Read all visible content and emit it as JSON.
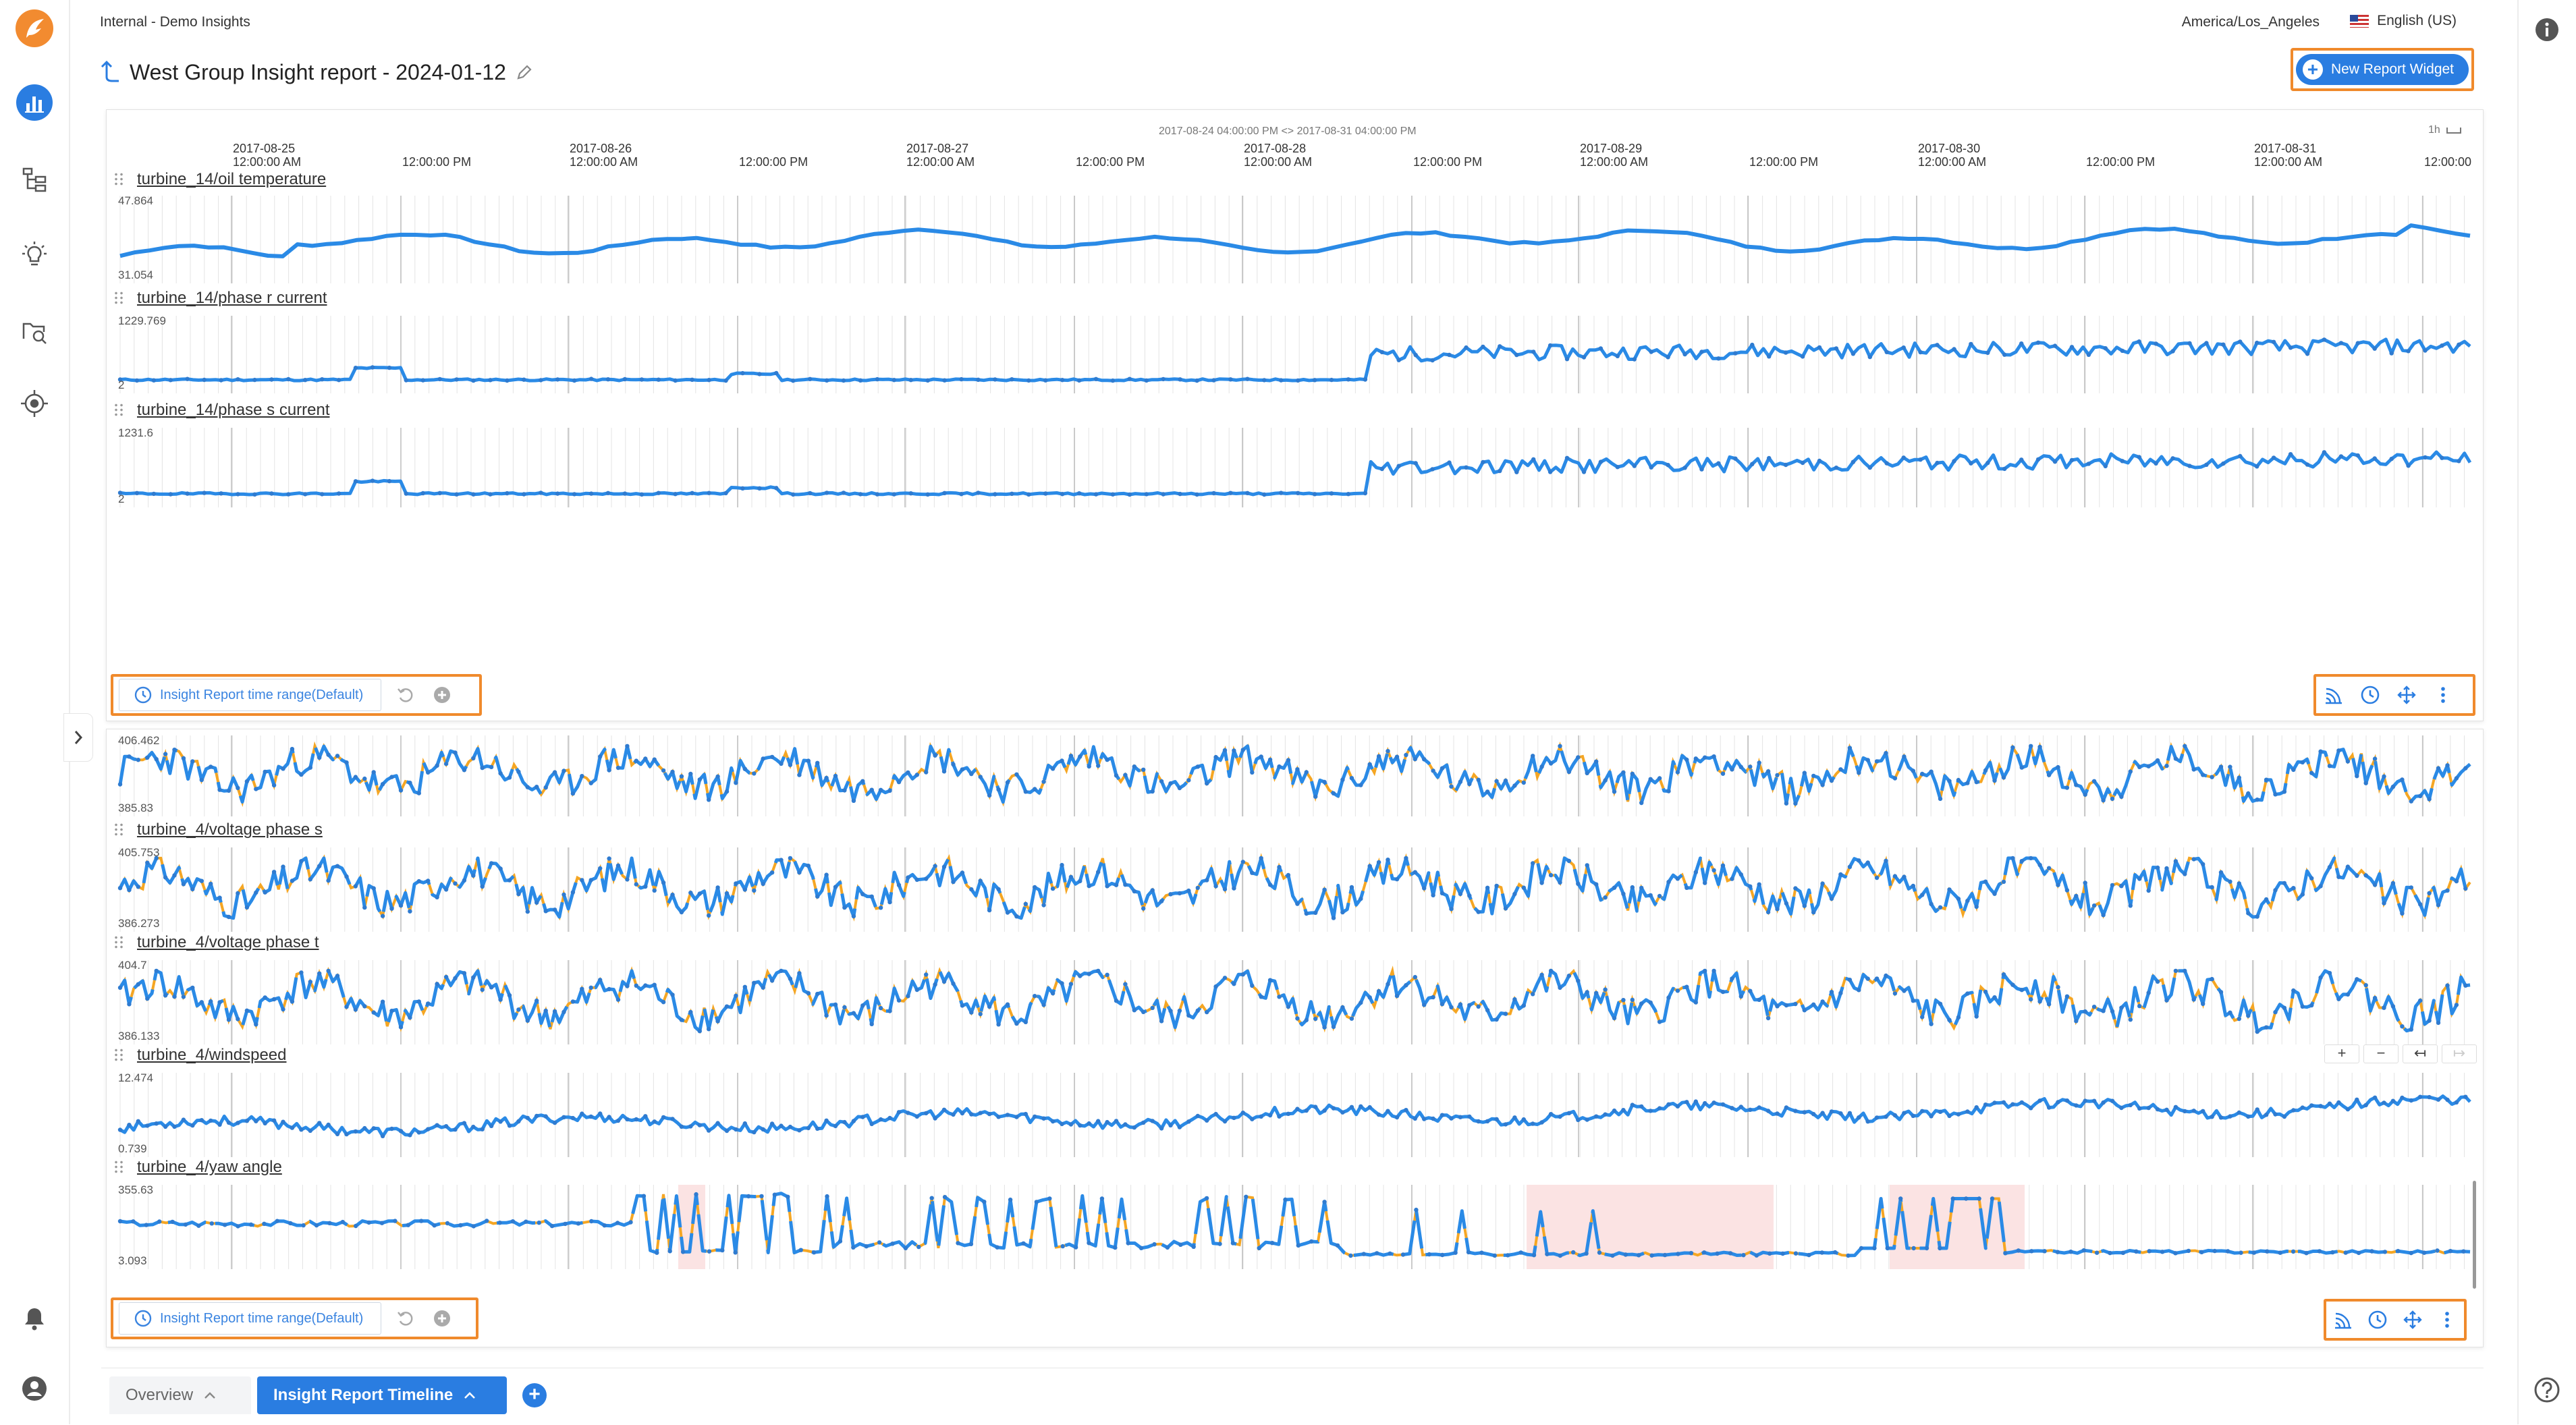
{
  "app": {
    "breadcrumb": "Internal - Demo Insights",
    "timezone": "America/Los_Angeles",
    "language": "English (US)"
  },
  "report": {
    "title": "West Group Insight report - 2024-01-12",
    "new_widget_label": "New Report Widget"
  },
  "timeline": {
    "range_caption": "2017-08-24 04:00:00 PM <> 2017-08-31 04:00:00 PM",
    "interval_label": "1h",
    "ticks": [
      {
        "date": "2017-08-25",
        "time": "12:00:00 AM"
      },
      {
        "date": "",
        "time": "12:00:00 PM"
      },
      {
        "date": "2017-08-26",
        "time": "12:00:00 AM"
      },
      {
        "date": "",
        "time": "12:00:00 PM"
      },
      {
        "date": "2017-08-27",
        "time": "12:00:00 AM"
      },
      {
        "date": "",
        "time": "12:00:00 PM"
      },
      {
        "date": "2017-08-28",
        "time": "12:00:00 AM"
      },
      {
        "date": "",
        "time": "12:00:00 PM"
      },
      {
        "date": "2017-08-29",
        "time": "12:00:00 AM"
      },
      {
        "date": "",
        "time": "12:00:00 PM"
      },
      {
        "date": "2017-08-30",
        "time": "12:00:00 AM"
      },
      {
        "date": "",
        "time": "12:00:00 PM"
      },
      {
        "date": "2017-08-31",
        "time": "12:00:00 AM"
      },
      {
        "date": "",
        "time": "12:00:00"
      }
    ]
  },
  "widget1": {
    "charts": [
      {
        "name": "turbine_14/oil temperature",
        "ymax": "47.864",
        "ymin": "31.054"
      },
      {
        "name": "turbine_14/phase r current",
        "ymax": "1229.769",
        "ymin": "2"
      },
      {
        "name": "turbine_14/phase s current",
        "ymax": "1231.6",
        "ymin": "2"
      }
    ],
    "range_button": "Insight Report time range(Default)"
  },
  "widget2": {
    "charts": [
      {
        "name": "",
        "ymax": "406.462",
        "ymin": "385.83"
      },
      {
        "name": "turbine_4/voltage phase s",
        "ymax": "405.753",
        "ymin": "386.273"
      },
      {
        "name": "turbine_4/voltage phase t",
        "ymax": "404.7",
        "ymin": "386.133"
      },
      {
        "name": "turbine_4/windspeed",
        "ymax": "12.474",
        "ymin": "0.739"
      },
      {
        "name": "turbine_4/yaw angle",
        "ymax": "355.63",
        "ymin": "3.093"
      }
    ],
    "range_button": "Insight Report time range(Default)",
    "zoom": [
      "+",
      "−",
      "↤",
      "↦"
    ]
  },
  "tabs": [
    {
      "label": "Overview",
      "active": false
    },
    {
      "label": "Insight Report Timeline",
      "active": true
    }
  ],
  "colors": {
    "accent": "#2a7de1",
    "highlight": "#f08a2c",
    "series": "#2a8ae6",
    "anomaly": "#f5a623"
  }
}
